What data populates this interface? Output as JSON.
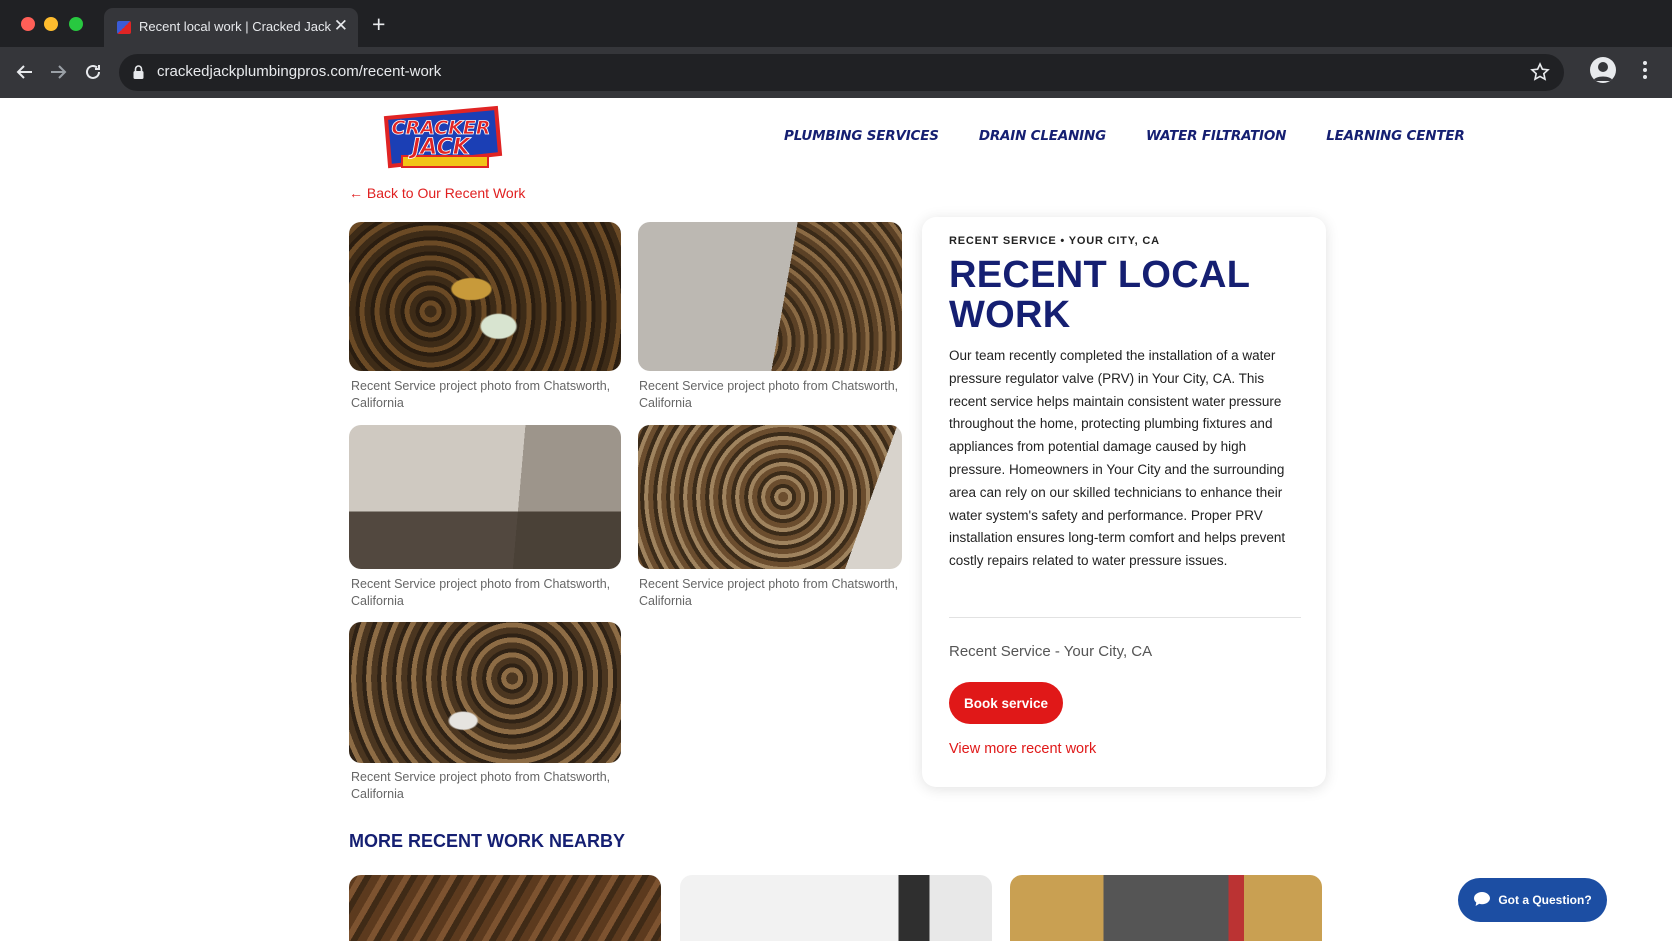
{
  "browser": {
    "tab_title": "Recent local work | Cracked Jack",
    "url": "crackedjackplumbingpros.com/recent-work"
  },
  "header": {
    "logo_text_top": "CRACKER",
    "logo_text_bottom": "JACK",
    "nav": [
      "PLUMBING SERVICES",
      "DRAIN CLEANING",
      "WATER FILTRATION",
      "LEARNING CENTER"
    ]
  },
  "back_link": "← Back to Our Recent Work",
  "gallery": [
    {
      "caption": "Recent Service project photo from Chatsworth, California"
    },
    {
      "caption": "Recent Service project photo from Chatsworth, California"
    },
    {
      "caption": "Recent Service project photo from Chatsworth, California"
    },
    {
      "caption": "Recent Service project photo from Chatsworth, California"
    },
    {
      "caption": "Recent Service project photo from Chatsworth, California"
    }
  ],
  "card": {
    "eyebrow": "RECENT SERVICE • YOUR CITY, CA",
    "title": "RECENT LOCAL WORK",
    "body": "Our team recently completed the installation of a water pressure regulator valve (PRV) in Your City, CA. This recent service helps maintain consistent water pressure throughout the home, protecting plumbing fixtures and appliances from potential damage caused by high pressure. Homeowners in Your City and the surrounding area can rely on our skilled technicians to enhance their water system's safety and performance. Proper PRV installation ensures long-term comfort and helps prevent costly repairs related to water pressure issues.",
    "subtitle": "Recent Service - Your City, CA",
    "book_label": "Book service",
    "more_link": "View more recent work"
  },
  "nearby": {
    "title": "MORE RECENT WORK NEARBY"
  },
  "chat": {
    "label": "Got a Question?"
  },
  "colors": {
    "brand_navy": "#151f72",
    "accent_red": "#e01818",
    "chat_blue": "#1c4ea3"
  }
}
